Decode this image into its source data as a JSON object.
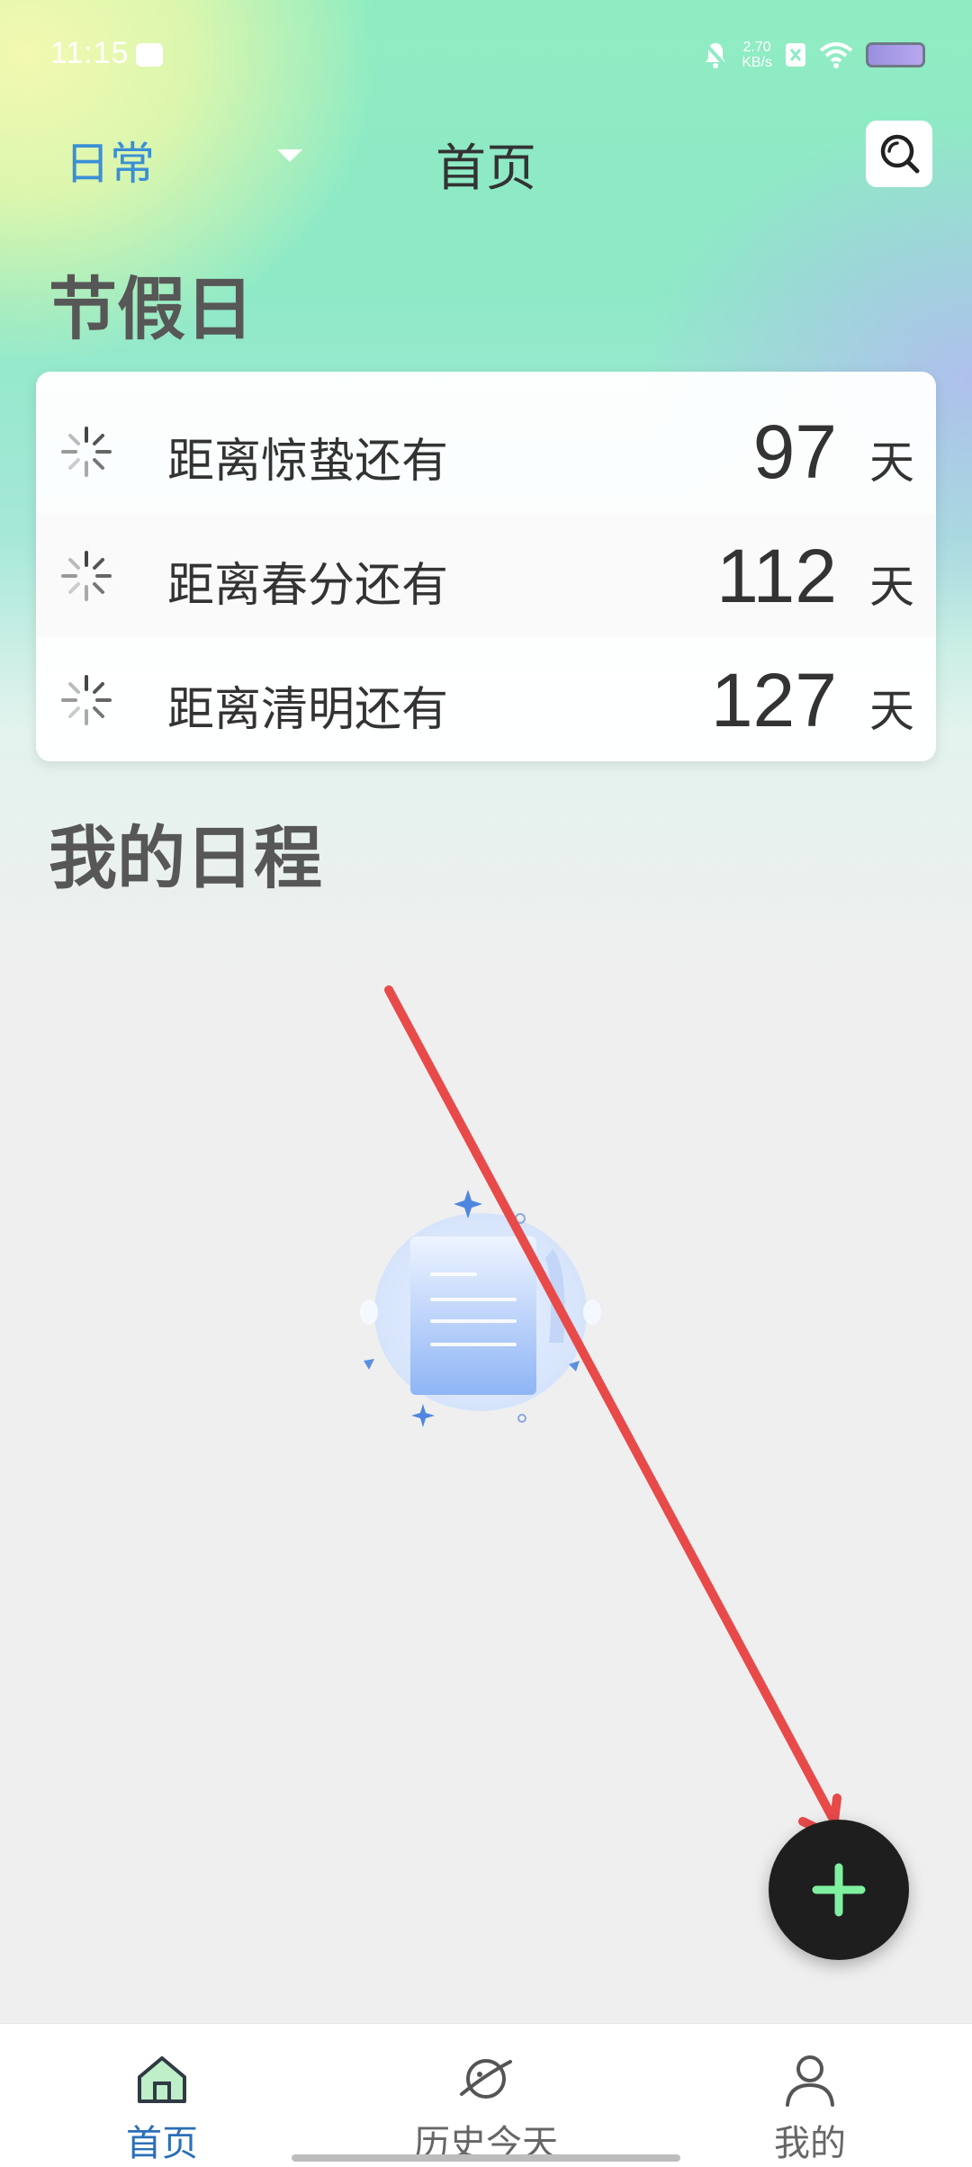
{
  "status_bar": {
    "time": "11:15",
    "net_speed_value": "2.70",
    "net_speed_unit": "KB/s"
  },
  "header": {
    "category": "日常",
    "title": "首页"
  },
  "holidays": {
    "section_title": "节假日",
    "items": [
      {
        "label": "距离惊蛰还有",
        "days": "97",
        "unit": "天"
      },
      {
        "label": "距离春分还有",
        "days": "112",
        "unit": "天"
      },
      {
        "label": "距离清明还有",
        "days": "127",
        "unit": "天"
      }
    ]
  },
  "schedule": {
    "section_title": "我的日程"
  },
  "bottom_nav": {
    "items": [
      {
        "label": "首页",
        "icon": "home-icon",
        "active": true
      },
      {
        "label": "历史今天",
        "icon": "planet-icon",
        "active": false
      },
      {
        "label": "我的",
        "icon": "person-icon",
        "active": false
      }
    ]
  },
  "colors": {
    "accent_blue": "#3a8fd6",
    "fab_background": "#1e1e1e",
    "fab_plus": "#7ff0a0",
    "annotation_arrow": "#e84a4a"
  }
}
